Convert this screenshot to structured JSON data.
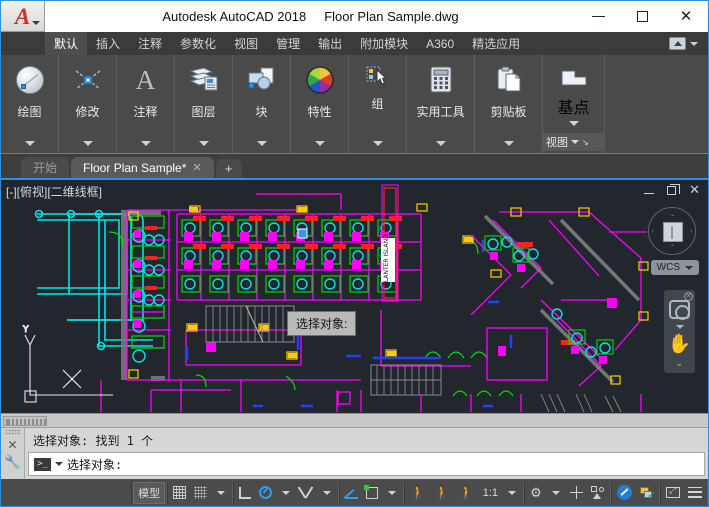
{
  "window": {
    "app_title": "Autodesk AutoCAD 2018",
    "document_title": "Floor Plan Sample.dwg",
    "app_logo": "autocad-a-logo",
    "controls": {
      "minimize": "minimize-icon",
      "maximize": "maximize-icon",
      "close": "close-icon"
    }
  },
  "ribbon": {
    "tabs": [
      {
        "label": "默认",
        "active": true
      },
      {
        "label": "插入",
        "active": false
      },
      {
        "label": "注释",
        "active": false
      },
      {
        "label": "参数化",
        "active": false
      },
      {
        "label": "视图",
        "active": false
      },
      {
        "label": "管理",
        "active": false
      },
      {
        "label": "输出",
        "active": false
      },
      {
        "label": "附加模块",
        "active": false
      },
      {
        "label": "A360",
        "active": false
      },
      {
        "label": "精选应用",
        "active": false
      }
    ],
    "panels": [
      {
        "label": "绘图",
        "icon": "circle-draw-icon"
      },
      {
        "label": "修改",
        "icon": "move-modify-icon"
      },
      {
        "label": "注释",
        "icon": "text-a-icon"
      },
      {
        "label": "图层",
        "icon": "layers-icon"
      },
      {
        "label": "块",
        "icon": "block-icon"
      },
      {
        "label": "特性",
        "icon": "color-wheel-icon"
      },
      {
        "label": "组",
        "icon": "group-select-icon"
      },
      {
        "label": "实用工具",
        "icon": "calculator-icon"
      },
      {
        "label": "剪贴板",
        "icon": "clipboard-icon"
      }
    ],
    "basepoint": {
      "label": "基点",
      "icon": "basepoint-icon"
    },
    "view_chip": {
      "label": "视图"
    }
  },
  "file_tabs": {
    "tabs": [
      {
        "label": "开始",
        "active": false,
        "closable": false
      },
      {
        "label": "Floor Plan Sample*",
        "active": true,
        "closable": true
      }
    ],
    "close_glyph": "✕",
    "new_tab_glyph": "+"
  },
  "viewport": {
    "controls_label": "[-][俯视][二维线框]",
    "wcs_label": "WCS",
    "tooltip": "选择对象:",
    "background_color": "#22272e",
    "window_buttons": {
      "minimize": "viewport-minimize-icon",
      "maximize": "viewport-maximize-icon",
      "close": "viewport-close-icon"
    },
    "drawing_text": {
      "planter_island": "PLANTER ISLAND"
    },
    "colors": {
      "walls": "#ff00ff",
      "pipes": "#00ffff",
      "furniture_green": "#00cc00",
      "highlight_red": "#ff0000",
      "fixtures_yellow": "#ffcc00",
      "grid_gray": "#8a8a8a",
      "blue_accent": "#0055ff"
    }
  },
  "navbar": {
    "items": [
      {
        "name": "zoom-tool",
        "glyph": "zoom"
      },
      {
        "name": "pan-tool",
        "glyph": "hand"
      }
    ],
    "close_glyph": "✕"
  },
  "command_line": {
    "history": "选择对象: 找到 1 个",
    "prompt_icon": ">_",
    "input_value": "选择对象:",
    "close_glyph": "✕",
    "settings_glyph": "🔧"
  },
  "status_bar": {
    "model_label": "模型",
    "scale_label": "1:1",
    "items": [
      {
        "name": "grid-display-toggle",
        "icon": "grid-icon"
      },
      {
        "name": "snap-mode-toggle",
        "icon": "snap-dots-icon"
      },
      {
        "name": "snap-dropdown",
        "icon": "chevron-down-icon"
      },
      {
        "name": "ortho-mode-toggle",
        "icon": "ortho-icon"
      },
      {
        "name": "polar-tracking-toggle",
        "icon": "polar-icon"
      },
      {
        "name": "polar-dropdown",
        "icon": "chevron-down-icon"
      },
      {
        "name": "object-snap-toggle",
        "icon": "osnap-icon"
      },
      {
        "name": "osnap-dropdown",
        "icon": "chevron-down-icon"
      },
      {
        "name": "object-snap-tracking",
        "icon": "otrack-icon"
      },
      {
        "name": "ucs-toggle",
        "icon": "ucs-icon"
      },
      {
        "name": "ucs-dropdown",
        "icon": "chevron-down-icon"
      },
      {
        "name": "dynamic-ucs-toggle",
        "icon": "person-blue-icon"
      },
      {
        "name": "selection-cycling-toggle",
        "icon": "person-gray-icon"
      },
      {
        "name": "annotation-monitor",
        "icon": "person-single-icon"
      },
      {
        "name": "annotation-scale",
        "icon": "scale-label"
      },
      {
        "name": "scale-dropdown",
        "icon": "chevron-down-icon"
      },
      {
        "name": "workspace-switch",
        "icon": "gear-icon"
      },
      {
        "name": "workspace-dropdown",
        "icon": "chevron-down-icon"
      },
      {
        "name": "annotation-visibility",
        "icon": "plus-icon"
      },
      {
        "name": "isolate-objects",
        "icon": "isolate-icon"
      },
      {
        "name": "hardware-acceleration",
        "icon": "blue-circle-icon"
      },
      {
        "name": "customization",
        "icon": "customize-icon"
      },
      {
        "name": "clean-screen",
        "icon": "clean-screen-icon"
      },
      {
        "name": "status-menu",
        "icon": "hamburger-icon"
      }
    ]
  },
  "colors": {
    "accent": "#2e8fe0",
    "ribbon_bg": "#4a4a4a",
    "tab_bg": "#3b3b3b",
    "status_bg": "#4b4b4b",
    "canvas_bg": "#22272e"
  }
}
